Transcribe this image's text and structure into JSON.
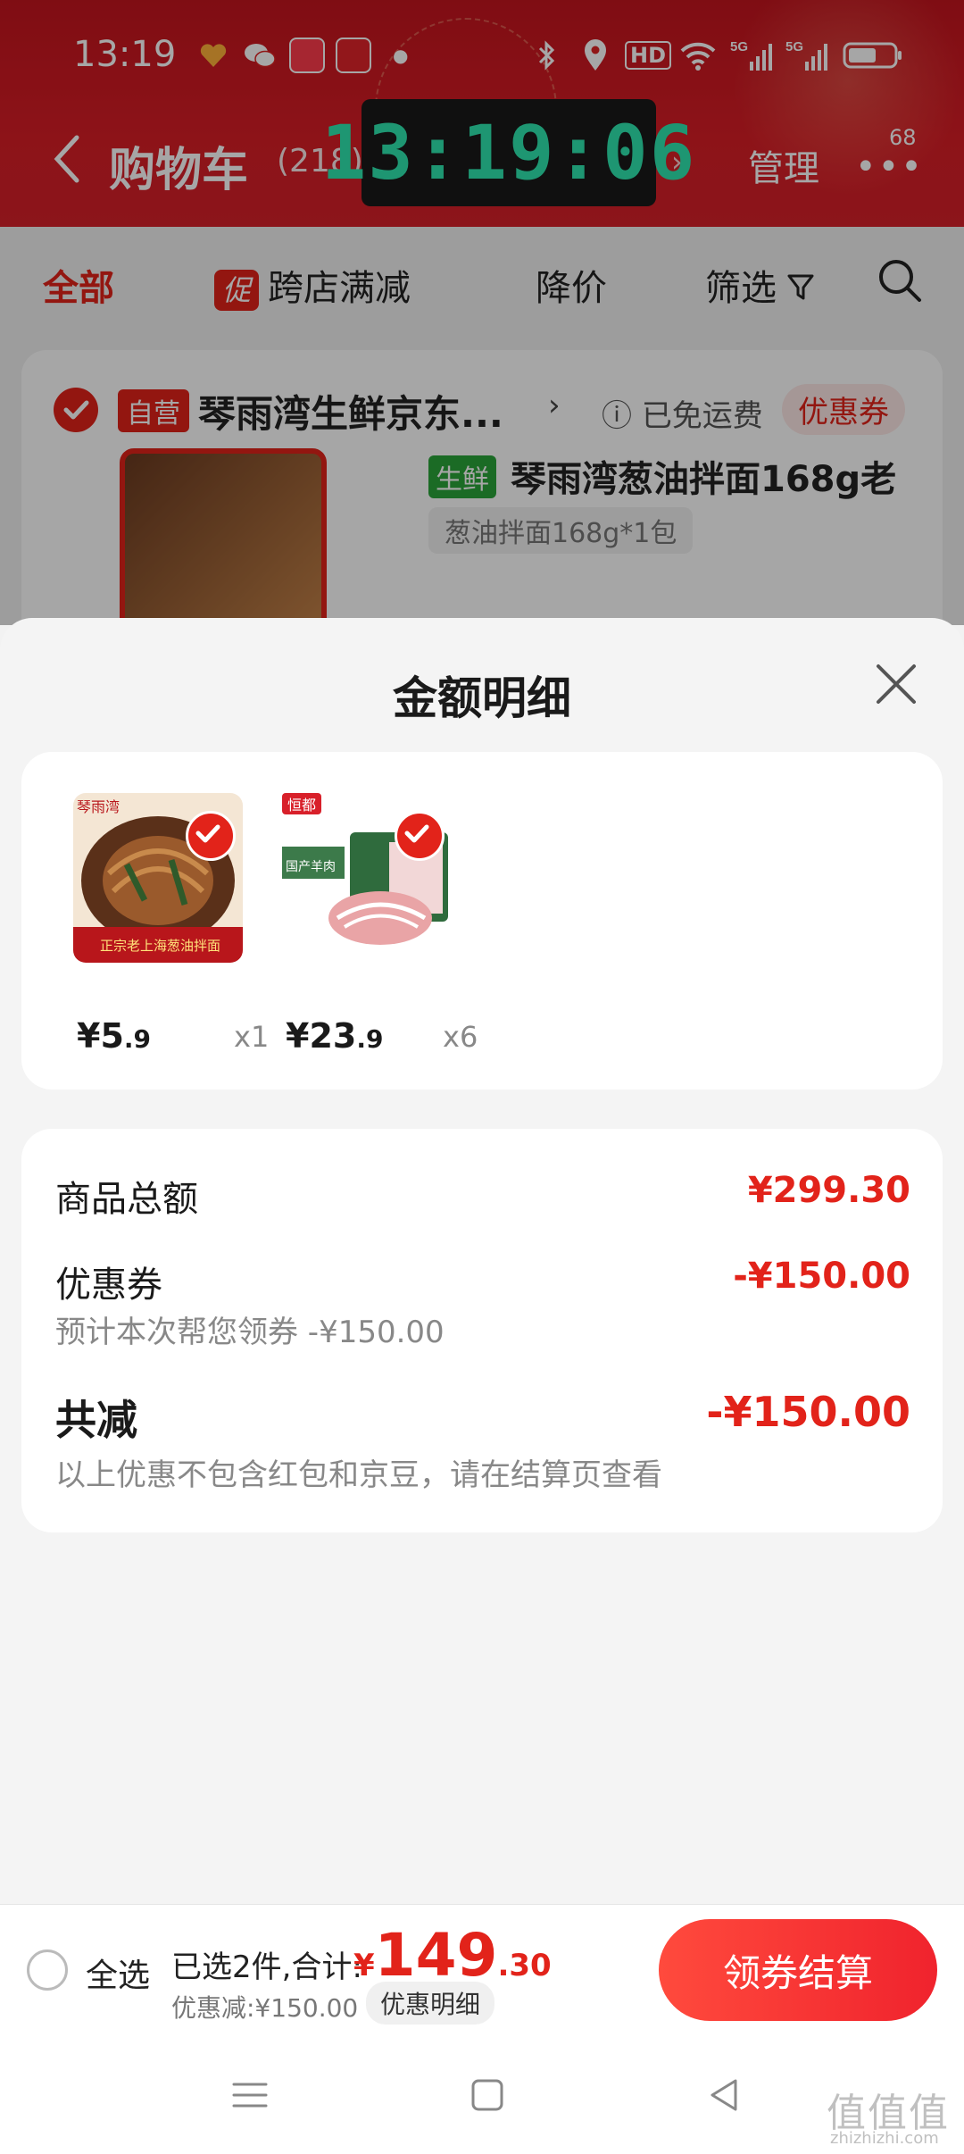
{
  "status": {
    "time": "13:19",
    "network_label": "5G",
    "hd_label": "HD"
  },
  "header": {
    "title": "购物车",
    "count": "(218)",
    "clock": "13:19:06",
    "manage": "管理",
    "more_badge": "68"
  },
  "tabs": {
    "all": "全部",
    "promo_badge": "促",
    "cross_store": "跨店满减",
    "price_drop": "降价",
    "filter": "筛选"
  },
  "shop": {
    "self_tag": "自营",
    "name": "琴雨湾生鲜京东...",
    "shipping": "已免运费",
    "coupon": "优惠券",
    "fresh_tag": "生鲜",
    "product_name": "琴雨湾葱油拌面168g老",
    "spec": "葱油拌面168g*1包"
  },
  "sheet": {
    "title": "金额明细",
    "items": [
      {
        "price_symbol": "¥",
        "price_int": "5",
        "price_dec": ".9",
        "qty": "x1",
        "brand": "琴雨湾",
        "caption": "正宗老上海葱油拌面"
      },
      {
        "price_symbol": "¥",
        "price_int": "23",
        "price_dec": ".9",
        "qty": "x6",
        "brand": "恒都",
        "caption": "国产羊肉"
      }
    ],
    "summary": {
      "goods_total_label": "商品总额",
      "goods_total_value": "¥299.30",
      "coupon_label": "优惠券",
      "coupon_value": "-¥150.00",
      "coupon_note": "预计本次帮您领券 -¥150.00",
      "total_discount_label": "共减",
      "total_discount_value": "-¥150.00",
      "total_discount_note": "以上优惠不包含红包和京豆，请在结算页查看"
    }
  },
  "checkout": {
    "select_all": "全选",
    "selected": "已选2件,合计:",
    "currency": "¥",
    "total_int": "149",
    "total_dec": ".30",
    "discount": "优惠减:¥150.00",
    "detail_button": "优惠明细",
    "button": "领券结算"
  },
  "watermark": {
    "main": "值值值",
    "sub": "zhizhizhi.com"
  },
  "colors": {
    "brand_red": "#e2231a",
    "clock_green": "#2ee6b0"
  }
}
